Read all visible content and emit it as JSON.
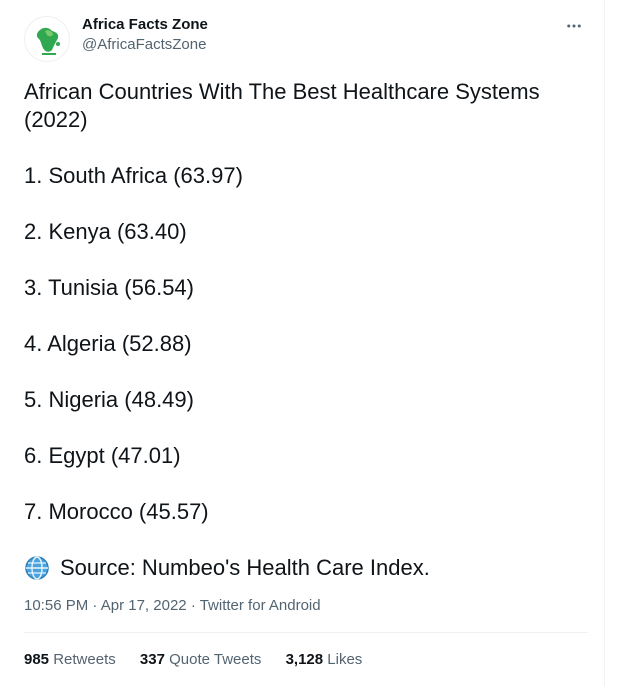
{
  "author": {
    "name": "Africa Facts Zone",
    "handle": "@AfricaFactsZone"
  },
  "tweet": {
    "title": "African Countries With The Best Healthcare Systems (2022)",
    "items": [
      "1. South Africa (63.97)",
      "2. Kenya (63.40)",
      "3. Tunisia (56.54)",
      "4. Algeria (52.88)",
      "5. Nigeria (48.49)",
      "6. Egypt (47.01)",
      "7. Morocco (45.57)"
    ],
    "source": "Source: Numbeo's Health Care Index."
  },
  "meta": {
    "time": "10:56 PM",
    "separator1": "·",
    "date": "Apr 17, 2022",
    "separator2": "·",
    "client": "Twitter for Android"
  },
  "stats": {
    "retweets_count": "985",
    "retweets_label": "Retweets",
    "quotes_count": "337",
    "quotes_label": "Quote Tweets",
    "likes_count": "3,128",
    "likes_label": "Likes"
  },
  "icons": {
    "avatar": "africa-map-logo",
    "more": "more-options-icon",
    "source": "globe-icon"
  },
  "colors": {
    "text_primary": "#0f1419",
    "text_secondary": "#536471",
    "divider": "#eff3f4"
  }
}
